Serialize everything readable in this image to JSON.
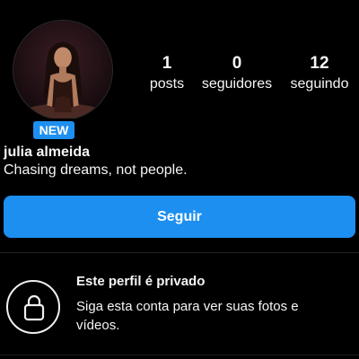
{
  "profile": {
    "badge": "NEW",
    "username": "julia almeida",
    "bio": "Chasing dreams, not people.",
    "avatar_icon": "profile-photo"
  },
  "stats": {
    "posts_count": "1",
    "posts_label": "posts",
    "followers_count": "0",
    "followers_label": "seguidores",
    "following_count": "12",
    "following_label": "seguindo"
  },
  "actions": {
    "follow_label": "Seguir"
  },
  "private_notice": {
    "title": "Este perfil é privado",
    "description": "Siga esta conta para ver suas fotos e vídeos.",
    "icon": "lock-icon"
  },
  "colors": {
    "background": "#000000",
    "accent": "#1d8ff0",
    "text": "#f5f5f5"
  }
}
